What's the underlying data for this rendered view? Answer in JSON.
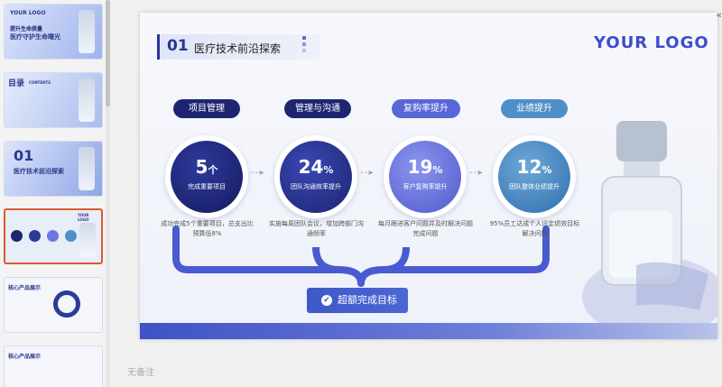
{
  "thumbnails": [
    {
      "title": "YOUR LOGO",
      "line1": "提升生命质量",
      "line2": "医疗守护生命曙光"
    },
    {
      "title": "目录",
      "line1": "CONTENTS"
    },
    {
      "title": "01",
      "line1": "医疗技术前沿探索"
    },
    {
      "title": "YOUR LOGO"
    },
    {
      "title": "核心产品展示"
    },
    {
      "title": "核心产品展示"
    }
  ],
  "slide": {
    "number": "01",
    "title": "医疗技术前沿探索",
    "logo": "YOUR LOGO",
    "target_button": "超额完成目标",
    "colors": {
      "accent": "#3b4fc8",
      "dark": "#1e2570"
    }
  },
  "metrics": [
    {
      "pill": "项目管理",
      "value": "5",
      "unit": "个",
      "caption": "完成重要项目",
      "desc": "成功完成5个重要项目，总支出比预算低8%"
    },
    {
      "pill": "管理与沟通",
      "value": "24",
      "unit": "%",
      "caption": "团队沟通效率提升",
      "desc": "实施每周团队会议，增加跨部门沟通频率"
    },
    {
      "pill": "复购率提升",
      "value": "19",
      "unit": "%",
      "caption": "客户复购率提升",
      "desc": "每月跟进客户问题并及时解决问题完成问题"
    },
    {
      "pill": "业绩提升",
      "value": "12",
      "unit": "%",
      "caption": "团队整体业绩提升",
      "desc": "95%员工达成个人设定绩效目标解决问题"
    }
  ],
  "notes": "无备注"
}
